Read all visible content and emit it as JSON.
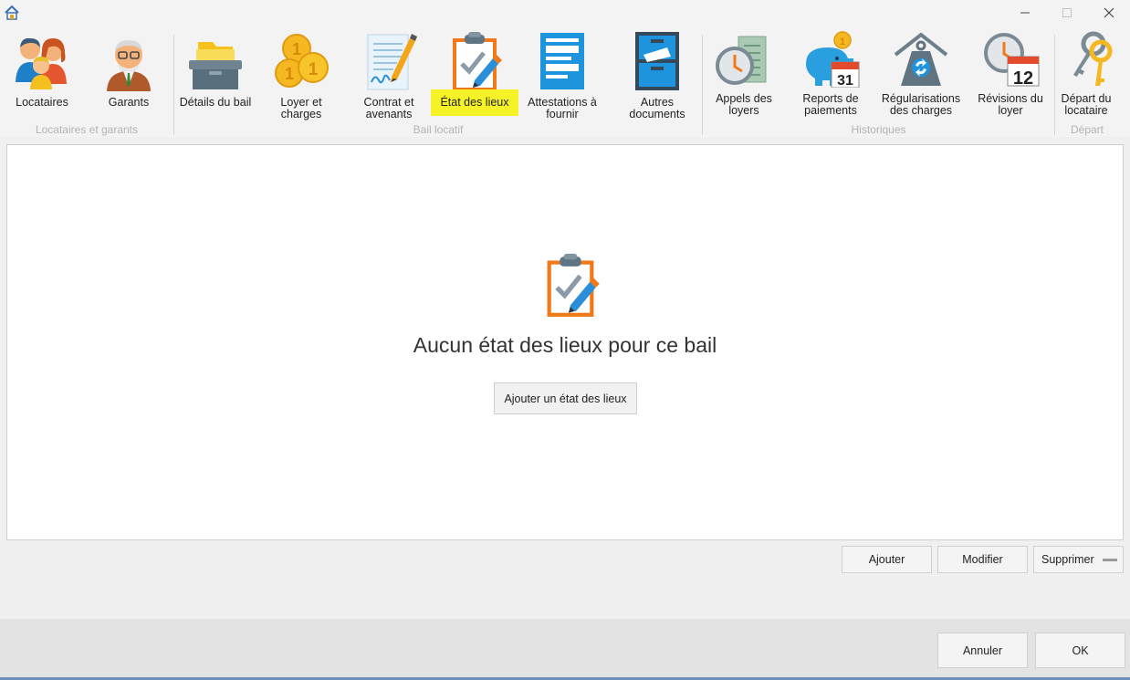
{
  "window": {
    "app_icon": "home-icon",
    "controls": [
      "minimize-icon",
      "maximize-icon",
      "close-icon"
    ]
  },
  "ribbon": {
    "groups": [
      {
        "label": "Locataires et garants"
      },
      {
        "label": "Bail locatif"
      },
      {
        "label": "Historiques"
      },
      {
        "label": "Départ"
      }
    ],
    "buttons": [
      {
        "label": "Locataires",
        "icon": "tenants-icon"
      },
      {
        "label": "Garants",
        "icon": "guarantor-icon"
      },
      {
        "label": "Détails du bail",
        "icon": "lease-details-icon"
      },
      {
        "label": "Loyer et\ncharges",
        "icon": "coins-icon"
      },
      {
        "label": "Contrat et\navenants",
        "icon": "contract-icon"
      },
      {
        "label": "État des lieux",
        "icon": "clipboard-icon",
        "active": true
      },
      {
        "label": "Attestations à\nfournir",
        "icon": "attestations-icon"
      },
      {
        "label": "Autres\ndocuments",
        "icon": "file-cabinet-icon"
      },
      {
        "label": "Appels des\nloyers",
        "icon": "rent-calls-icon"
      },
      {
        "label": "Reports de\npaiements",
        "icon": "piggy-bank-calendar-icon"
      },
      {
        "label": "Régularisations\ndes charges",
        "icon": "charges-weight-icon"
      },
      {
        "label": "Révisions du\nloyer",
        "icon": "clock-calendar-icon"
      },
      {
        "label": "Départ du\nlocataire",
        "icon": "keys-icon"
      }
    ]
  },
  "main": {
    "empty_message": "Aucun état des lieux pour ce bail",
    "add_button": "Ajouter un état des lieux"
  },
  "actions": {
    "ajouter": "Ajouter",
    "modifier": "Modifier",
    "supprimer": "Supprimer"
  },
  "footer": {
    "annuler": "Annuler",
    "ok": "OK"
  },
  "colors": {
    "highlight": "#f5f227",
    "accent_blue": "#2a8fd8",
    "accent_orange": "#f07a1a"
  }
}
